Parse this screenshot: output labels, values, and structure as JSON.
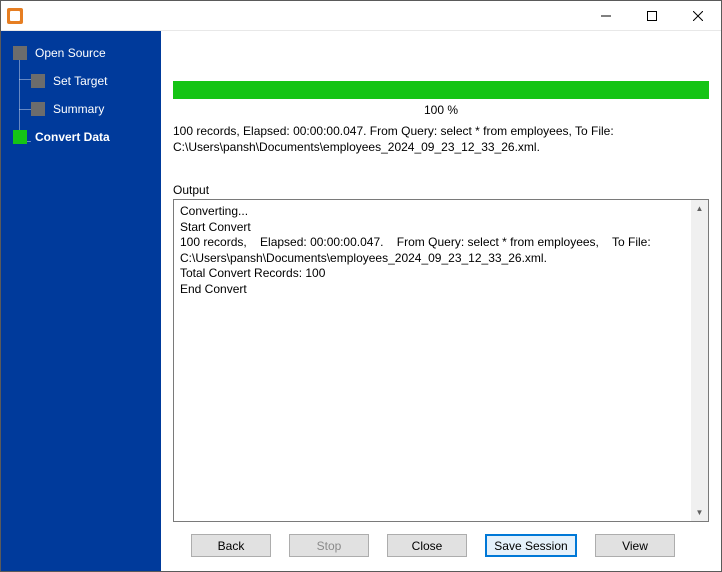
{
  "window": {
    "title": ""
  },
  "sidebar": {
    "steps": [
      {
        "label": "Open Source"
      },
      {
        "label": "Set Target"
      },
      {
        "label": "Summary"
      },
      {
        "label": "Convert Data"
      }
    ]
  },
  "progress": {
    "percent_text": "100 %"
  },
  "summary": "100 records,    Elapsed: 00:00:00.047.    From Query: select * from employees,    To File: C:\\Users\\pansh\\Documents\\employees_2024_09_23_12_33_26.xml.",
  "output": {
    "label": "Output",
    "text": "Converting...\nStart Convert\n100 records,    Elapsed: 00:00:00.047.    From Query: select * from employees,    To File: C:\\Users\\pansh\\Documents\\employees_2024_09_23_12_33_26.xml.\nTotal Convert Records: 100\nEnd Convert"
  },
  "buttons": {
    "back": "Back",
    "stop": "Stop",
    "close": "Close",
    "save_session": "Save Session",
    "view": "View"
  }
}
